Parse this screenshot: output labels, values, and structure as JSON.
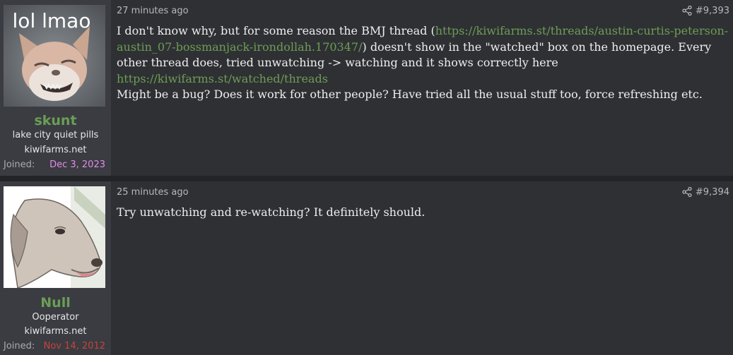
{
  "posts": [
    {
      "username": "skunt",
      "user_title": "lake city quiet pills",
      "user_site": "kiwifarms.net",
      "joined_label": "Joined:",
      "joined_date": "Dec 3, 2023",
      "joined_color": "#e58ae8",
      "avatar_text": "lol lmao",
      "timestamp": "27 minutes ago",
      "post_number": "#9,393",
      "message": {
        "p1_a": "I don't know why, but for some reason the BMJ thread (",
        "link1": "https://kiwifarms.st/threads/austin-curtis-peterson-austin_07-bossmanjack-irondollah.170347/",
        "p1_b": ") doesn't show in the \"watched\" box on the homepage. Every other thread does, tried unwatching -> watching and it shows correctly here ",
        "link2": "https://kiwifarms.st/watched/threads",
        "p2": "Might be a bug? Does it work for other people? Have tried all the usual stuff too, force refreshing etc."
      }
    },
    {
      "username": "Null",
      "user_title": "Ooperator",
      "user_site": "kiwifarms.net",
      "joined_label": "Joined:",
      "joined_date": "Nov 14, 2012",
      "joined_color": "#c9423a",
      "timestamp": "25 minutes ago",
      "post_number": "#9,394",
      "message": {
        "p1": "Try unwatching and re-watching? It definitely should."
      }
    }
  ],
  "icons": {
    "share": "share-icon"
  },
  "colors": {
    "link": "#6b9e55",
    "username": "#6b9e55",
    "background": "#2f3034",
    "userblock": "#3a3c42"
  }
}
